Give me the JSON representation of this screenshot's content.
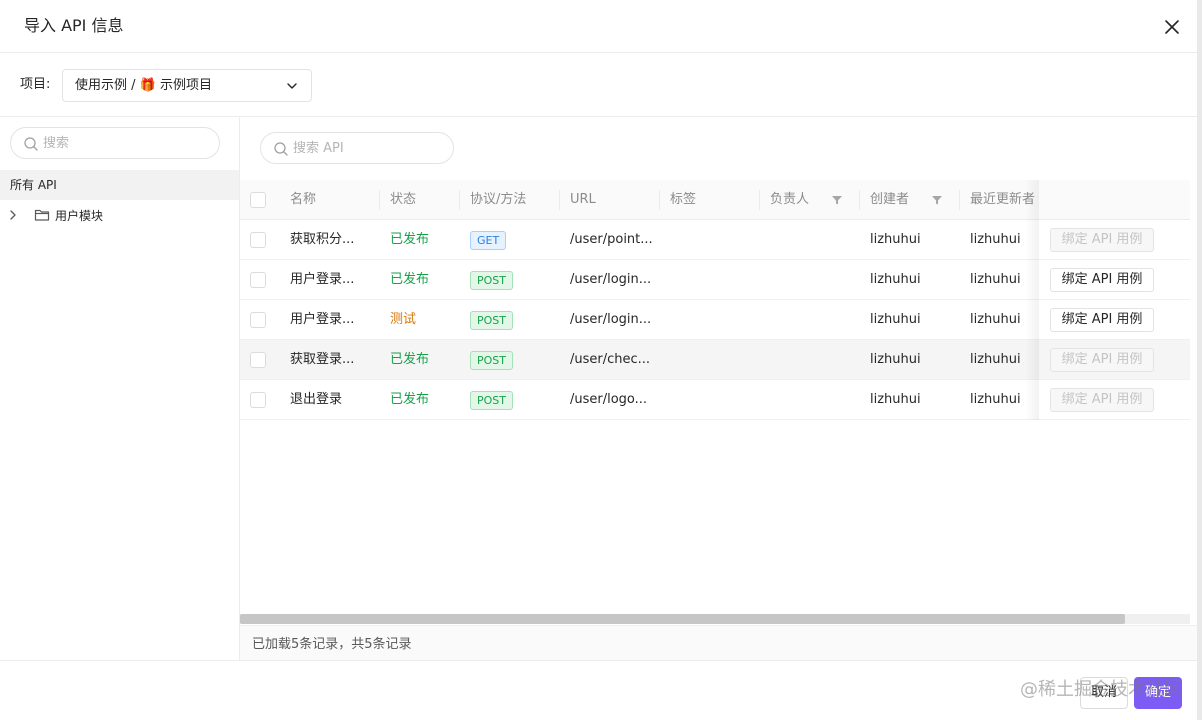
{
  "modal": {
    "title": "导入 API 信息",
    "close_icon": "close-icon"
  },
  "project": {
    "label": "项目:",
    "selected": "使用示例 / 🎁 示例项目",
    "icon": "chevron-down-icon"
  },
  "sidebar": {
    "search_placeholder": "搜索",
    "all_label": "所有 API",
    "tree": [
      {
        "label": "用户模块",
        "icon": "folder-icon",
        "expanded": false
      }
    ]
  },
  "api_search": {
    "placeholder": "搜索 API"
  },
  "table": {
    "columns": [
      "名称",
      "状态",
      "协议/方法",
      "URL",
      "标签",
      "负责人",
      "创建者",
      "最近更新者"
    ],
    "rows": [
      {
        "name": "获取积分...",
        "status": "已发布",
        "status_type": "published",
        "method": "GET",
        "url": "/user/point...",
        "tags": "",
        "owner": "",
        "creator": "lizhuhui",
        "updater": "lizhuhui",
        "action": "绑定 API 用例",
        "action_enabled": false
      },
      {
        "name": "用户登录...",
        "status": "已发布",
        "status_type": "published",
        "method": "POST",
        "url": "/user/login...",
        "tags": "",
        "owner": "",
        "creator": "lizhuhui",
        "updater": "lizhuhui",
        "action": "绑定 API 用例",
        "action_enabled": true
      },
      {
        "name": "用户登录...",
        "status": "测试",
        "status_type": "testing",
        "method": "POST",
        "url": "/user/login...",
        "tags": "",
        "owner": "",
        "creator": "lizhuhui",
        "updater": "lizhuhui",
        "action": "绑定 API 用例",
        "action_enabled": true
      },
      {
        "name": "获取登录...",
        "status": "已发布",
        "status_type": "published",
        "method": "POST",
        "url": "/user/chec...",
        "tags": "",
        "owner": "",
        "creator": "lizhuhui",
        "updater": "lizhuhui",
        "action": "绑定 API 用例",
        "action_enabled": false
      },
      {
        "name": "退出登录",
        "status": "已发布",
        "status_type": "published",
        "method": "POST",
        "url": "/user/logo...",
        "tags": "",
        "owner": "",
        "creator": "lizhuhui",
        "updater": "lizhuhui",
        "action": "绑定 API 用例",
        "action_enabled": false
      }
    ]
  },
  "footer_info": "已加载5条记录，共5条记录",
  "footer": {
    "cancel": "取消",
    "ok": "确定",
    "watermark": "@稀土掘金技术社区"
  },
  "colors": {
    "primary": "#7c5cf5",
    "published": "#16a34a",
    "testing": "#d97706",
    "get": "#2f7fe0"
  }
}
